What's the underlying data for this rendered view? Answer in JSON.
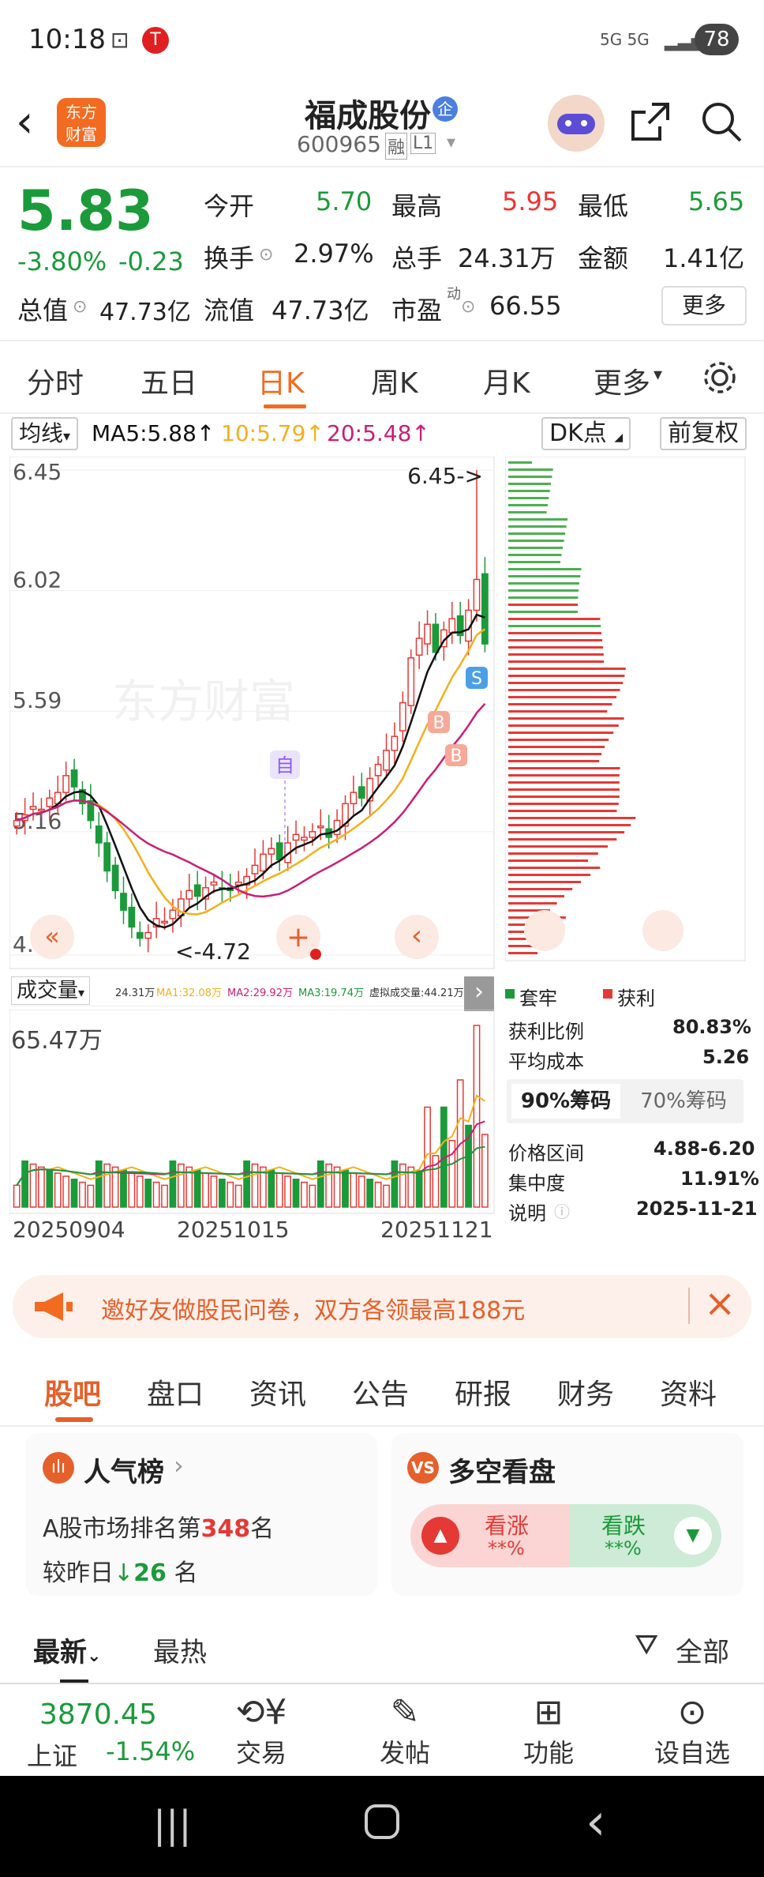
{
  "status": {
    "time": "10:18",
    "network": "5G 5G",
    "battery": "78"
  },
  "header": {
    "title": "福成股份",
    "badge": "企",
    "code": "600965",
    "tag1": "融",
    "tag2": "L1"
  },
  "quote": {
    "price": "5.83",
    "change_pct": "-3.80%",
    "change": "-0.23",
    "cap_label": "总值",
    "cap_value": "47.73亿",
    "rows": [
      {
        "l1": "今开",
        "v1": "5.70",
        "l2": "最高",
        "v2": "5.95",
        "l3": "最低",
        "v3": "5.65"
      },
      {
        "l1": "换手",
        "v1": "2.97%",
        "l2": "总手",
        "v2": "24.31万",
        "l3": "金额",
        "v3": "1.41亿"
      },
      {
        "l1": "流值",
        "v1": "47.73亿",
        "l2": "市盈",
        "v2": "66.55",
        "l3": "",
        "v3": ""
      }
    ],
    "pe_sup": "动",
    "more": "更多"
  },
  "period_tabs": [
    "分时",
    "五日",
    "日K",
    "周K",
    "月K",
    "更多"
  ],
  "active_tab": "日K",
  "chart_toolbar": {
    "ma_type": "均线",
    "ma5": "MA5:5.88",
    "ma10": "10:5.79",
    "ma20": "20:5.48",
    "dk": "DK点",
    "adj": "前复权"
  },
  "kline": {
    "y_labels": [
      "6.45",
      "6.02",
      "5.59",
      "5.16",
      "4.72"
    ],
    "high_label": "6.45->",
    "low_label": "<-4.72",
    "marker_zi": "自",
    "marker_b": "B",
    "marker_s": "S",
    "watermark": "东方财富"
  },
  "volume": {
    "label": "成交量",
    "legend": [
      "24.31万",
      "MA1:32.08万",
      "MA2:29.92万",
      "MA3:19.74万",
      "虚拟成交量:44.21万"
    ],
    "max_label": "65.47万",
    "dates": [
      "20250904",
      "20251015",
      "20251121"
    ]
  },
  "chips": {
    "legend_trapped": "套牢",
    "legend_profit": "获利",
    "rows": [
      {
        "k": "获利比例",
        "v": "80.83%"
      },
      {
        "k": "平均成本",
        "v": "5.26"
      }
    ],
    "tab90": "90%筹码",
    "tab70": "70%筹码",
    "rows2": [
      {
        "k": "价格区间",
        "v": "4.88-6.20"
      },
      {
        "k": "集中度",
        "v": "11.91%"
      },
      {
        "k": "说明",
        "v": "2025-11-21"
      }
    ]
  },
  "banner": {
    "text": "邀好友做股民问卷，双方各领最高188元"
  },
  "section_tabs": [
    "股吧",
    "盘口",
    "资讯",
    "公告",
    "研报",
    "财务",
    "资料"
  ],
  "popular": {
    "title": "人气榜",
    "line1a": "A股市场排名第",
    "rank": "348",
    "line1b": "名",
    "line2a": "较昨日",
    "change": "26",
    "line2b": "名"
  },
  "bullbear": {
    "title": "多空看盘",
    "up": "看涨",
    "up_val": "**%",
    "down": "看跌",
    "down_val": "**%"
  },
  "filter": {
    "latest": "最新",
    "hot": "最热",
    "all": "全部"
  },
  "bottom": {
    "index_value": "3870.45",
    "index_name": "上证",
    "index_change": "-1.54%",
    "trade": "交易",
    "post": "发帖",
    "func": "功能",
    "watch": "设自选"
  },
  "colors": {
    "up": "#e53935",
    "down": "#1b9a3a",
    "accent": "#f26b21",
    "ma5": "#111111",
    "ma10": "#f2b01e",
    "ma20": "#c81e78"
  }
}
